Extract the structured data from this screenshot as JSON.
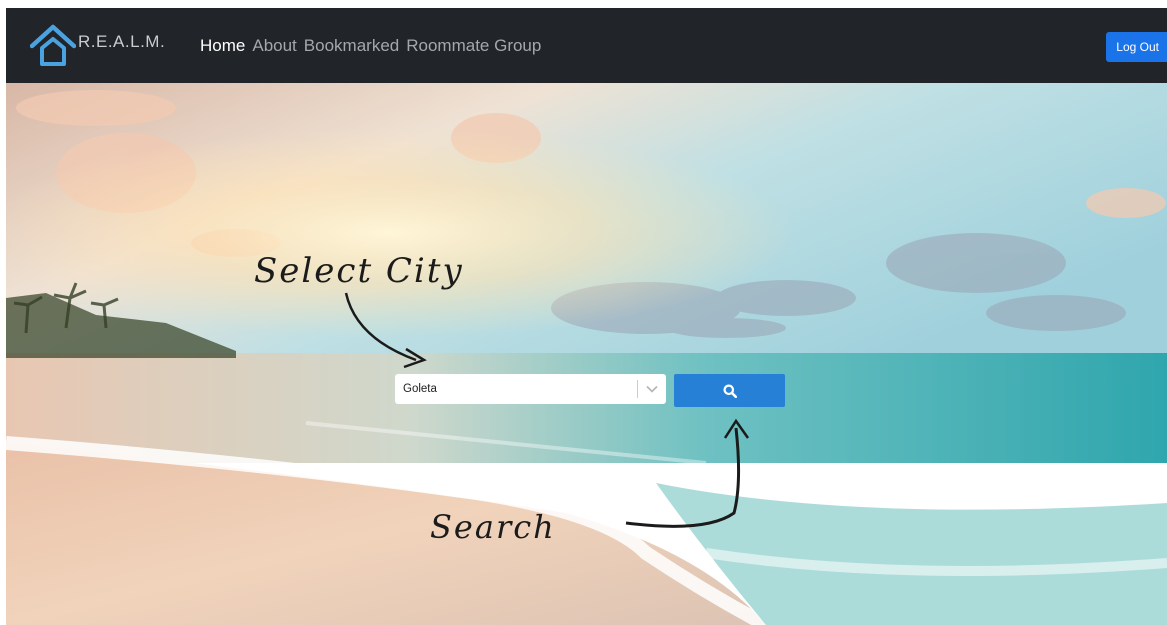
{
  "navbar": {
    "brand": "R.E.A.L.M.",
    "links": [
      {
        "label": "Home",
        "active": true
      },
      {
        "label": "About",
        "active": false
      },
      {
        "label": "Bookmarked",
        "active": false
      },
      {
        "label": "Roommate Group",
        "active": false
      }
    ],
    "logout_label": "Log Out"
  },
  "hero": {
    "city_select": {
      "value": "Goleta"
    },
    "annotations": {
      "select_city": "Select City",
      "search": "Search"
    }
  },
  "icons": {
    "brand_logo": "house-outline-icon",
    "select_chevron": "chevron-down-icon",
    "search": "search-icon"
  },
  "colors": {
    "navbar_bg": "#212429",
    "logout_button": "#1a73e8",
    "search_button": "#2580d6"
  }
}
